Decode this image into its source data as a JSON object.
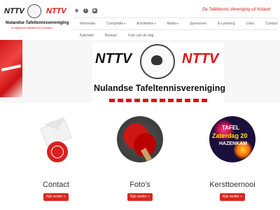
{
  "header": {
    "logo": {
      "left": "NTTV",
      "right": "NTTV",
      "club_name": "Nulandse Tafeltennisvereniging",
      "subtitle": "al vijftig jaar tafeltennis in Nuland"
    },
    "social": {
      "rss": "rss-icon",
      "facebook": "facebook-icon",
      "youtube": "youtube-icon"
    },
    "tagline": "De Tafeltennis Vereniging uit Nuland"
  },
  "nav": {
    "row1": [
      {
        "label": "Informatie",
        "dropdown": false
      },
      {
        "label": "Competitie",
        "dropdown": true
      },
      {
        "label": "Activiteiten",
        "dropdown": true
      },
      {
        "label": "Media",
        "dropdown": true
      },
      {
        "label": "Sponsoren",
        "dropdown": false
      },
      {
        "label": "E-Learning",
        "dropdown": false
      },
      {
        "label": "Links",
        "dropdown": false
      },
      {
        "label": "Contact",
        "dropdown": false
      }
    ],
    "row2": [
      {
        "label": "Kalender"
      },
      {
        "label": "Bestuur"
      },
      {
        "label": "Foto van de dag"
      }
    ]
  },
  "banner": {
    "left": "NTTV",
    "right": "NTTV",
    "title": "Nulandse Tafeltennisvereniging"
  },
  "features": [
    {
      "title": "Contact",
      "button": "Kijk verder »",
      "icon": "email-at-icon"
    },
    {
      "title": "Foto's",
      "button": "Kijk verder »",
      "icon": "table-tennis-paddle-icon"
    },
    {
      "title": "Kersttoernooi",
      "button": "Kijk verder »",
      "icon": "fireworks-image"
    }
  ],
  "kerst_image_text": {
    "line1": "TAFEL",
    "line2": "Zaterdag 20",
    "line3": "HAZENKAM"
  },
  "colors": {
    "accent": "#d9271e",
    "brand_red": "#e01010"
  }
}
